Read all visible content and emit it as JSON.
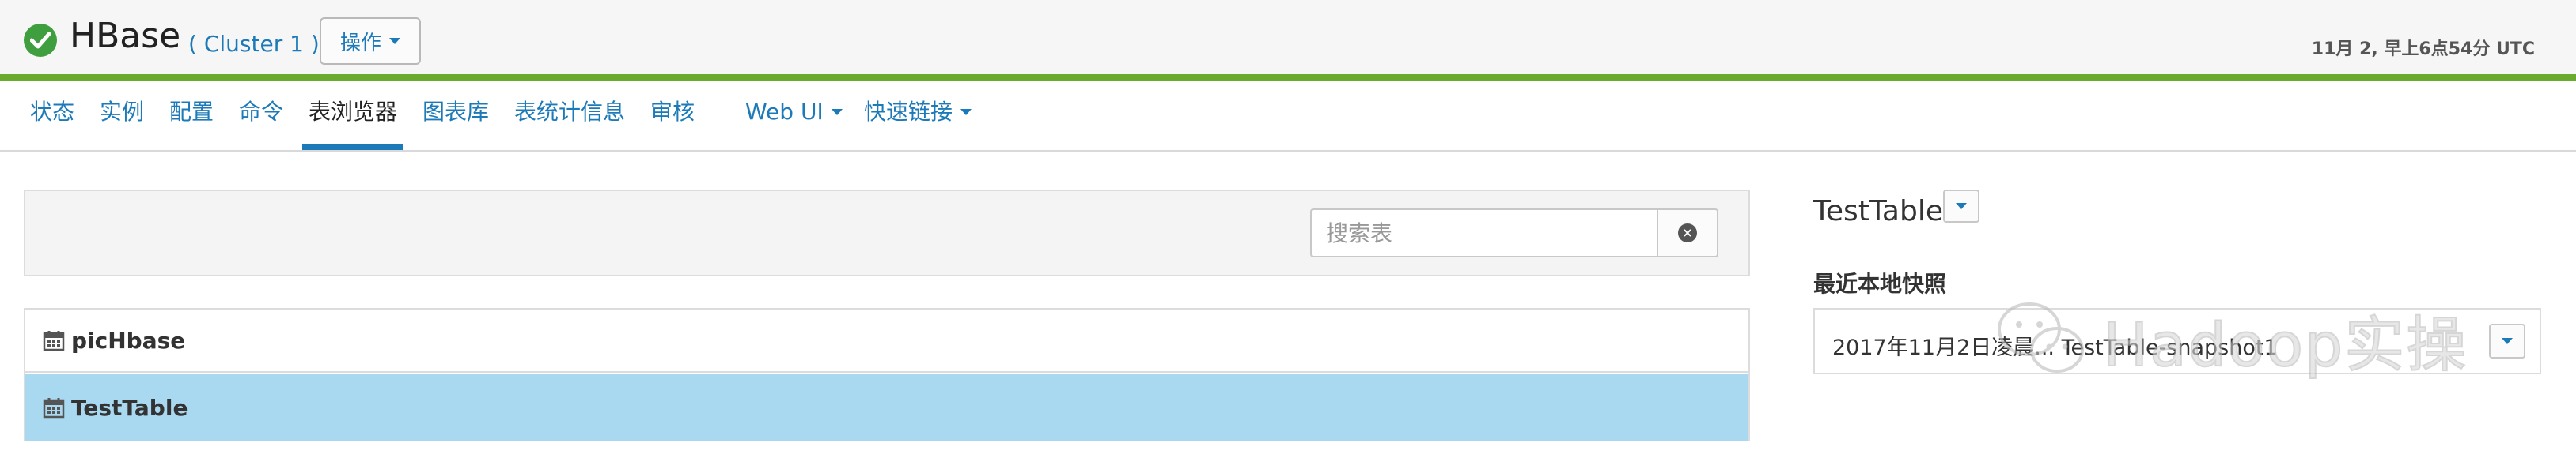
{
  "header": {
    "service_name": "HBase",
    "cluster_link": "( Cluster 1 )",
    "actions_label": "操作",
    "timestamp": "11月 2, 早上6点54分 UTC"
  },
  "colors": {
    "accent_blue": "#1d7ab8",
    "status_green": "#3f9e3d",
    "header_bar_green": "#6aab2e",
    "selected_row": "#a9d9f1"
  },
  "nav": {
    "items": [
      {
        "label": "状态"
      },
      {
        "label": "实例"
      },
      {
        "label": "配置"
      },
      {
        "label": "命令"
      },
      {
        "label": "表浏览器",
        "active": true
      },
      {
        "label": "图表库"
      },
      {
        "label": "表统计信息"
      },
      {
        "label": "审核"
      },
      {
        "label": "Web UI",
        "dropdown": true
      },
      {
        "label": "快速链接",
        "dropdown": true
      }
    ]
  },
  "search": {
    "placeholder": "搜索表"
  },
  "tables": [
    {
      "name": "picHbase",
      "selected": false
    },
    {
      "name": "TestTable",
      "selected": true
    }
  ],
  "detail": {
    "table_title": "TestTable",
    "snapshots_label": "最近本地快照",
    "snapshot_value": "2017年11月2日凌晨... TestTable-snapshot1"
  },
  "watermark": {
    "text": "Hadoop实操",
    "icon": "wechat-icon"
  }
}
